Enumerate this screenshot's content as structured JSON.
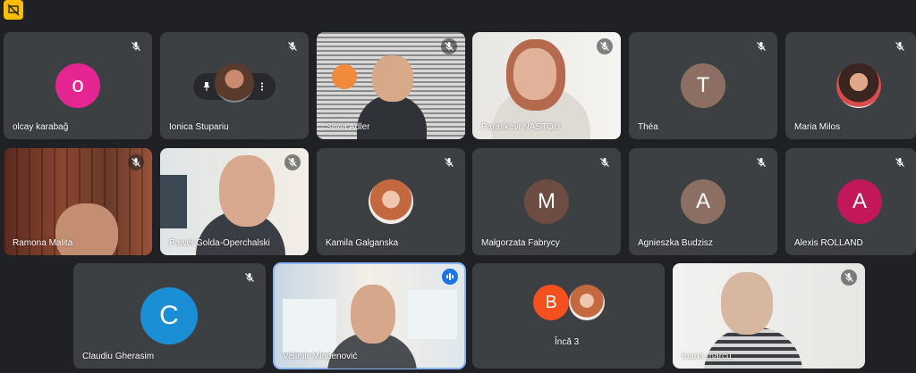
{
  "meeting": {
    "status_icon": "no-presentation-icon",
    "participants": [
      {
        "name": "olcay karabağ",
        "initial": "o",
        "avatar_color": "#e52592",
        "muted": true
      },
      {
        "name": "Ionica Stupariu",
        "muted": true,
        "controls": [
          "pin-icon",
          "more-vert-icon"
        ]
      },
      {
        "name": "Silvia Adler",
        "muted": true
      },
      {
        "name": "Paraskevi NASTOU",
        "muted": true
      },
      {
        "name": "Théa",
        "initial": "T",
        "avatar_color": "#8d6e63",
        "muted": true
      },
      {
        "name": "Maria Milos",
        "muted": true
      },
      {
        "name": "Ramona Malita",
        "muted": true
      },
      {
        "name": "Paweł Golda-Operchalski",
        "muted": true
      },
      {
        "name": "Kamila Galganska",
        "muted": true
      },
      {
        "name": "Małgorzata Fabrycy",
        "initial": "M",
        "avatar_color": "#6d4c41",
        "muted": true
      },
      {
        "name": "Agnieszka Budzisz",
        "initial": "A",
        "avatar_color": "#8d6e63",
        "muted": true
      },
      {
        "name": "Alexis ROLLAND",
        "initial": "A",
        "avatar_color": "#c2185b",
        "muted": true
      },
      {
        "name": "Claudiu Gherasim",
        "initial": "C",
        "avatar_color": "#1a8fd6",
        "muted": true
      },
      {
        "name": "Velimir Mladenović",
        "muted": false,
        "speaking": true
      },
      {
        "name": "Ioana marcu",
        "muted": true
      }
    ],
    "others": {
      "label": "Încă 3",
      "initial": "B",
      "avatar_color": "#f4511e"
    }
  }
}
